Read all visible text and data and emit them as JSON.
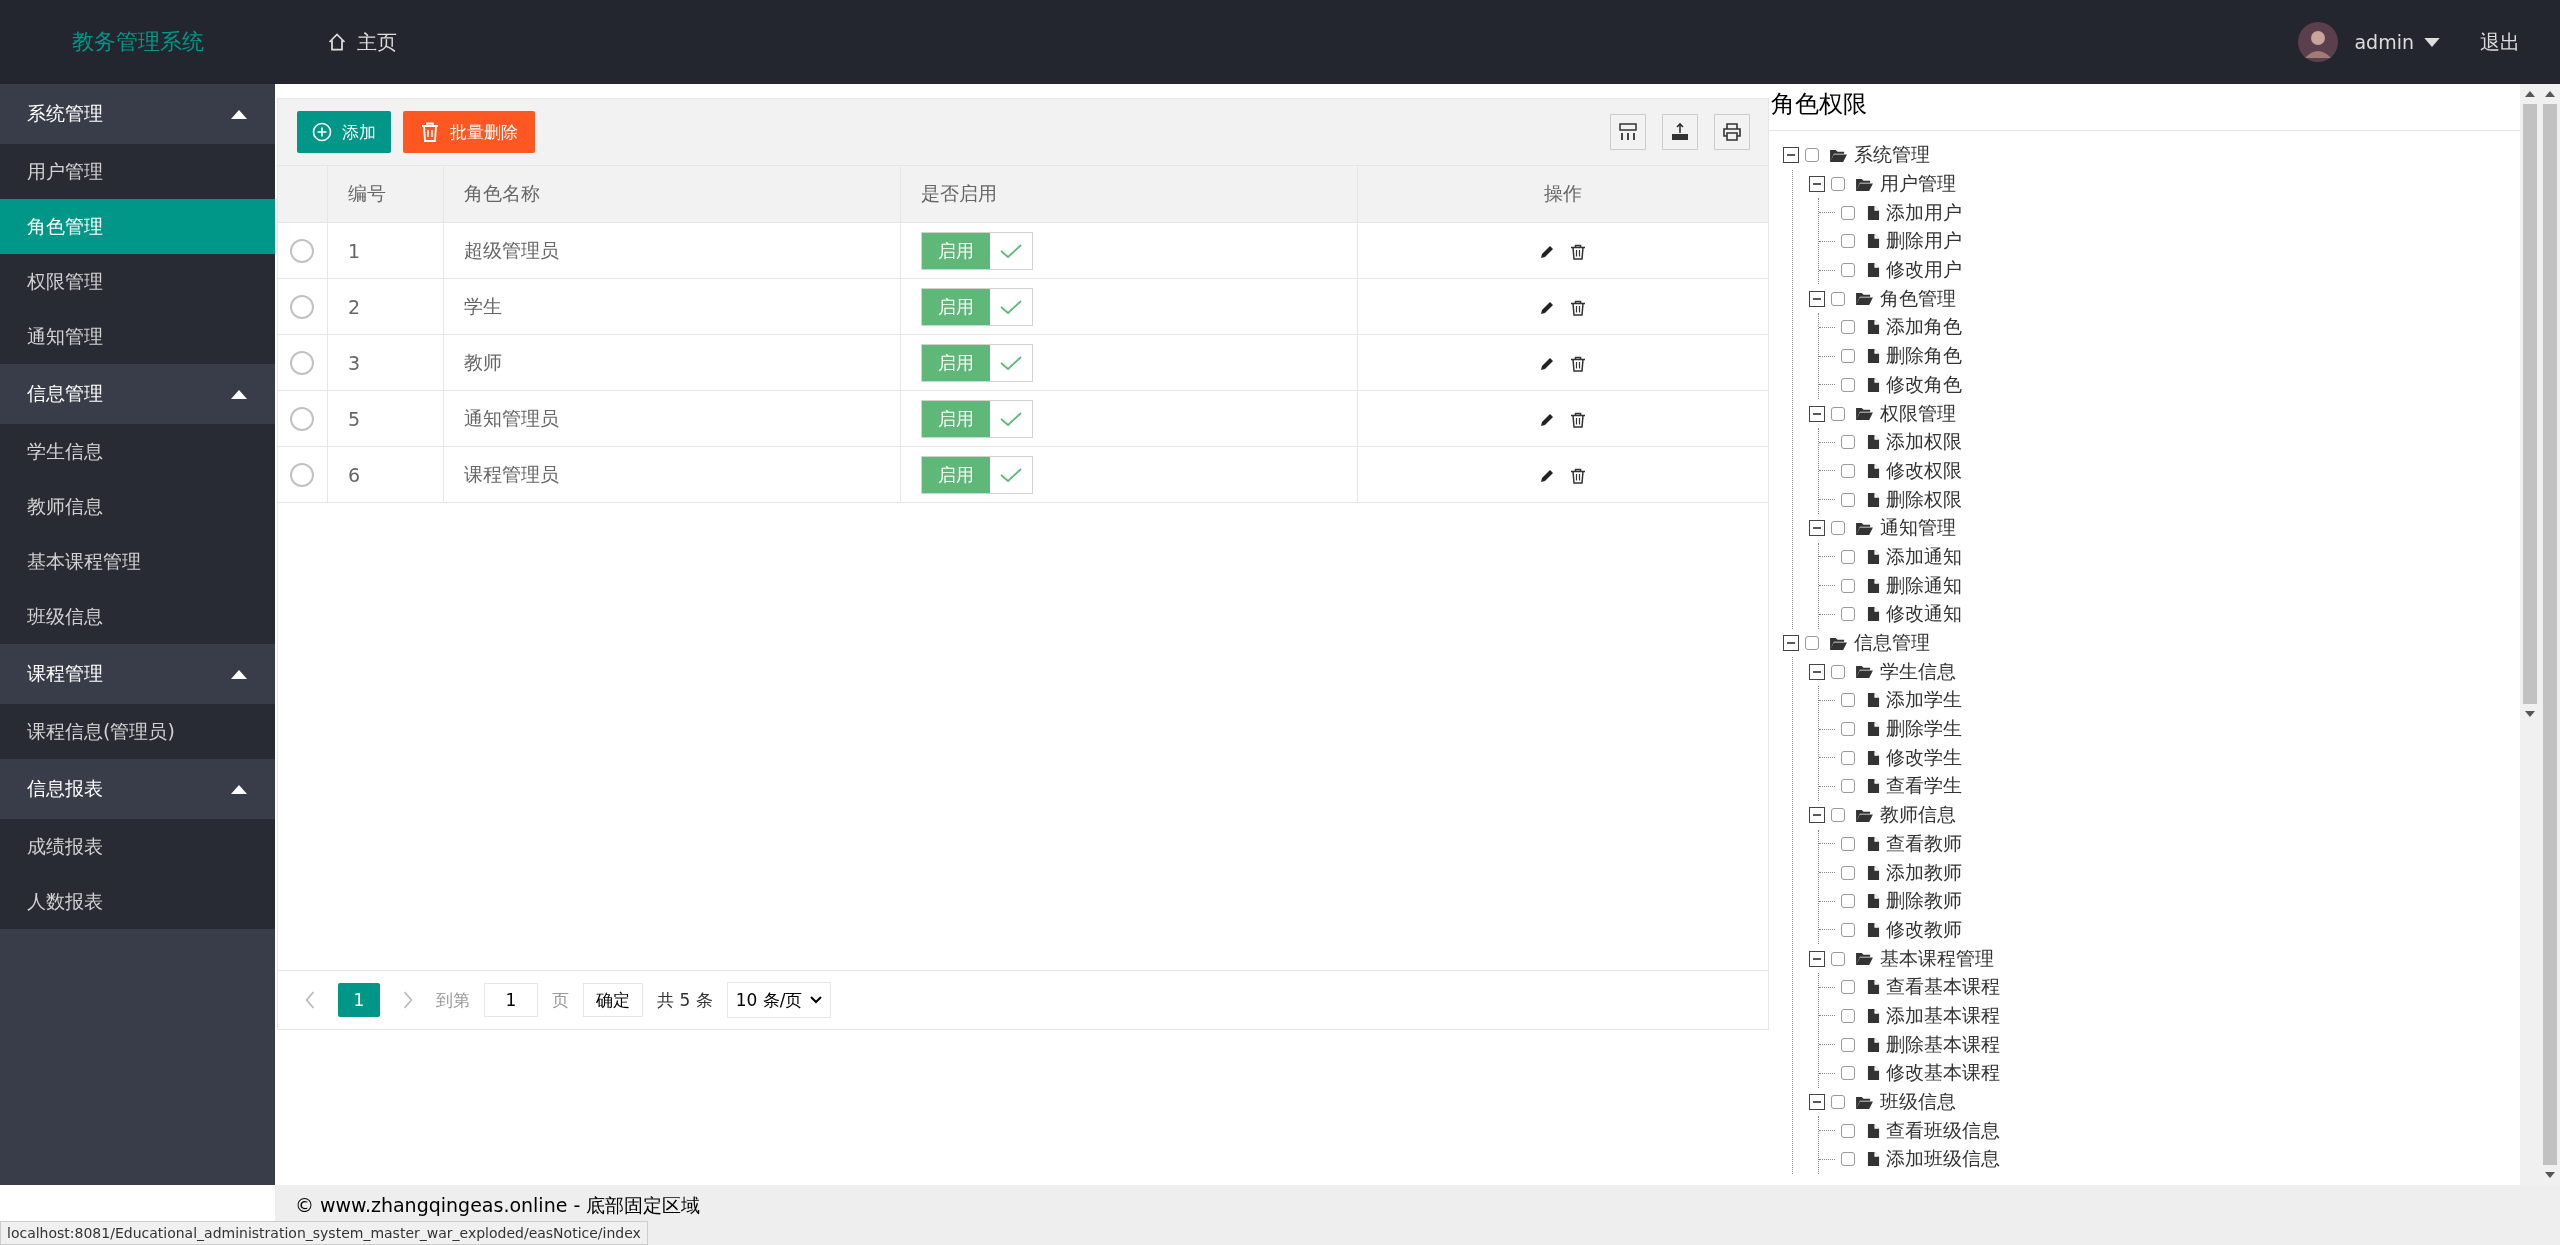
{
  "header": {
    "logo": "教务管理系统",
    "nav": [
      {
        "label": "主页"
      }
    ],
    "user": "admin",
    "logout": "退出"
  },
  "sidebar": {
    "groups": [
      {
        "title": "系统管理",
        "expanded": true,
        "items": [
          {
            "label": "用户管理",
            "selected": false
          },
          {
            "label": "角色管理",
            "selected": true
          },
          {
            "label": "权限管理",
            "selected": false
          },
          {
            "label": "通知管理",
            "selected": false
          }
        ]
      },
      {
        "title": "信息管理",
        "expanded": true,
        "items": [
          {
            "label": "学生信息",
            "selected": false
          },
          {
            "label": "教师信息",
            "selected": false
          },
          {
            "label": "基本课程管理",
            "selected": false
          },
          {
            "label": "班级信息",
            "selected": false
          }
        ]
      },
      {
        "title": "课程管理",
        "expanded": true,
        "items": [
          {
            "label": "课程信息(管理员)",
            "selected": false
          }
        ]
      },
      {
        "title": "信息报表",
        "expanded": true,
        "items": [
          {
            "label": "成绩报表",
            "selected": false
          },
          {
            "label": "人数报表",
            "selected": false
          }
        ]
      }
    ]
  },
  "toolbar": {
    "buttons": [
      {
        "kind": "add",
        "label": "添加"
      },
      {
        "kind": "delete",
        "label": "批量删除"
      }
    ]
  },
  "table": {
    "columns": [
      "编号",
      "角色名称",
      "是否启用",
      "操作"
    ],
    "rows": [
      {
        "id": "1",
        "name": "超级管理员",
        "selected": false,
        "enabled": true,
        "switch_label": "启用"
      },
      {
        "id": "2",
        "name": "学生",
        "selected": false,
        "enabled": true,
        "switch_label": "启用"
      },
      {
        "id": "3",
        "name": "教师",
        "selected": false,
        "enabled": true,
        "switch_label": "启用"
      },
      {
        "id": "5",
        "name": "通知管理员",
        "selected": false,
        "enabled": true,
        "switch_label": "启用"
      },
      {
        "id": "6",
        "name": "课程管理员",
        "selected": false,
        "enabled": true,
        "switch_label": "启用"
      }
    ]
  },
  "pagination": {
    "pages": [
      {
        "label": "1",
        "selected": true
      }
    ],
    "goto_label": "到第",
    "goto_value": "1",
    "page_unit": "页",
    "confirm": "确定",
    "total": "共 5 条",
    "page_size": "10 条/页"
  },
  "permissions": {
    "title": "角色权限",
    "tree": [
      {
        "label": "系统管理",
        "checked": false,
        "expanded": true,
        "children": [
          {
            "label": "用户管理",
            "checked": false,
            "expanded": true,
            "children": [
              {
                "label": "添加用户",
                "checked": false
              },
              {
                "label": "删除用户",
                "checked": false
              },
              {
                "label": "修改用户",
                "checked": false
              }
            ]
          },
          {
            "label": "角色管理",
            "checked": false,
            "expanded": true,
            "children": [
              {
                "label": "添加角色",
                "checked": false
              },
              {
                "label": "删除角色",
                "checked": false
              },
              {
                "label": "修改角色",
                "checked": false
              }
            ]
          },
          {
            "label": "权限管理",
            "checked": false,
            "expanded": true,
            "children": [
              {
                "label": "添加权限",
                "checked": false
              },
              {
                "label": "修改权限",
                "checked": false
              },
              {
                "label": "删除权限",
                "checked": false
              }
            ]
          },
          {
            "label": "通知管理",
            "checked": false,
            "expanded": true,
            "children": [
              {
                "label": "添加通知",
                "checked": false
              },
              {
                "label": "删除通知",
                "checked": false
              },
              {
                "label": "修改通知",
                "checked": false
              }
            ]
          }
        ]
      },
      {
        "label": "信息管理",
        "checked": false,
        "expanded": true,
        "children": [
          {
            "label": "学生信息",
            "checked": false,
            "expanded": true,
            "children": [
              {
                "label": "添加学生",
                "checked": false
              },
              {
                "label": "删除学生",
                "checked": false
              },
              {
                "label": "修改学生",
                "checked": false
              },
              {
                "label": "查看学生",
                "checked": false
              }
            ]
          },
          {
            "label": "教师信息",
            "checked": false,
            "expanded": true,
            "children": [
              {
                "label": "查看教师",
                "checked": false
              },
              {
                "label": "添加教师",
                "checked": false
              },
              {
                "label": "删除教师",
                "checked": false
              },
              {
                "label": "修改教师",
                "checked": false
              }
            ]
          },
          {
            "label": "基本课程管理",
            "checked": false,
            "expanded": true,
            "children": [
              {
                "label": "查看基本课程",
                "checked": false
              },
              {
                "label": "添加基本课程",
                "checked": false
              },
              {
                "label": "删除基本课程",
                "checked": false
              },
              {
                "label": "修改基本课程",
                "checked": false
              }
            ]
          },
          {
            "label": "班级信息",
            "checked": false,
            "expanded": true,
            "children": [
              {
                "label": "查看班级信息",
                "checked": false
              },
              {
                "label": "添加班级信息",
                "checked": false
              }
            ]
          }
        ]
      }
    ]
  },
  "footer": "© www.zhangqingeas.online - 底部固定区域",
  "status_bar": "localhost:8081/Educational_administration_system_master_war_exploded/easNotice/index"
}
